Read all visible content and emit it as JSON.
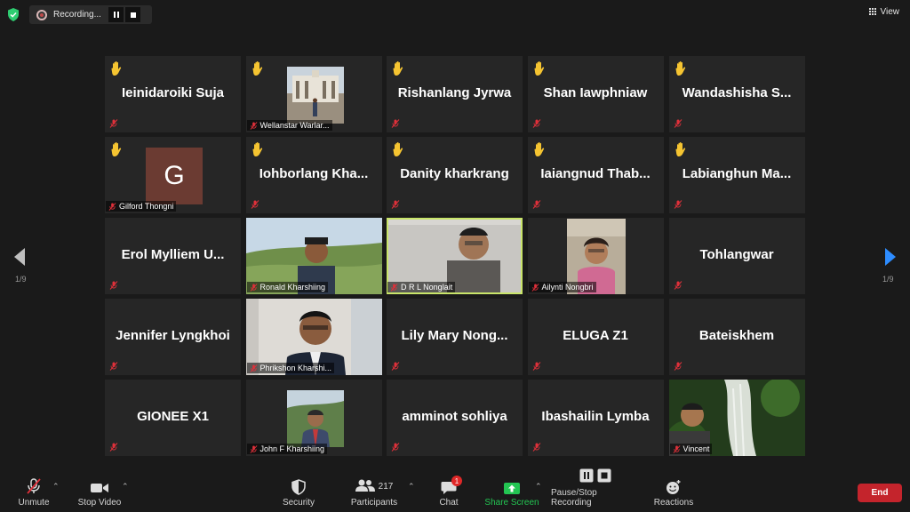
{
  "topbar": {
    "recording_label": "Recording...",
    "view_label": "View"
  },
  "navigation": {
    "page_indicator_left": "1/9",
    "page_indicator_right": "1/9"
  },
  "participants": [
    {
      "display": "Ieinidaroiki Suja",
      "hand": true,
      "video": false
    },
    {
      "display": "Wellanstar Warlar...",
      "hand": true,
      "video": true
    },
    {
      "display": "Rishanlang Jyrwa",
      "hand": true,
      "video": false
    },
    {
      "display": "Shan Iawphniaw",
      "hand": true,
      "video": false
    },
    {
      "display": "Wandashisha S...",
      "hand": true,
      "video": false
    },
    {
      "display": "Gilford Thongni",
      "avatar_letter": "G",
      "hand": true,
      "video": false
    },
    {
      "display": "Iohborlang Kha...",
      "hand": true,
      "video": false
    },
    {
      "display": "Danity kharkrang",
      "hand": true,
      "video": false
    },
    {
      "display": "Iaiangnud Thab...",
      "hand": true,
      "video": false
    },
    {
      "display": "Labianghun Ma...",
      "hand": true,
      "video": false
    },
    {
      "display": "Erol Mylliem U...",
      "hand": false,
      "video": false
    },
    {
      "display": "Ronald Kharshiing",
      "hand": false,
      "video": true
    },
    {
      "display": "D R L Nonglait",
      "hand": false,
      "video": true,
      "active_speaker": true
    },
    {
      "display": "Ailynti Nongbri",
      "hand": false,
      "video": true
    },
    {
      "display": "Tohlangwar",
      "hand": false,
      "video": false
    },
    {
      "display": "Jennifer Lyngkhoi",
      "hand": false,
      "video": false
    },
    {
      "display": "Phrikshon Kharshi...",
      "hand": false,
      "video": true
    },
    {
      "display": "Lily Mary Nong...",
      "hand": false,
      "video": false
    },
    {
      "display": "ELUGA Z1",
      "hand": false,
      "video": false
    },
    {
      "display": "Bateiskhem",
      "hand": false,
      "video": false
    },
    {
      "display": "GIONEE X1",
      "hand": false,
      "video": false
    },
    {
      "display": "John F Kharshiing",
      "hand": false,
      "video": true
    },
    {
      "display": "amminot sohliya",
      "hand": false,
      "video": false
    },
    {
      "display": "Ibashailin Lymba",
      "hand": false,
      "video": false
    },
    {
      "display": "Vincent",
      "hand": false,
      "video": true
    }
  ],
  "toolbar": {
    "unmute_label": "Unmute",
    "stop_video_label": "Stop Video",
    "security_label": "Security",
    "participants_label": "Participants",
    "participants_count": "217",
    "chat_label": "Chat",
    "chat_badge": "1",
    "share_screen_label": "Share Screen",
    "recording_label": "Pause/Stop Recording",
    "reactions_label": "Reactions",
    "end_label": "End"
  },
  "colors": {
    "background": "#1a1a1a",
    "tile": "#262626",
    "active_speaker_border": "#c9e56a",
    "end_button": "#c4242c",
    "share_green": "#23c552",
    "hand_yellow": "#f5c431",
    "mic_muted_red": "#e0303a"
  }
}
